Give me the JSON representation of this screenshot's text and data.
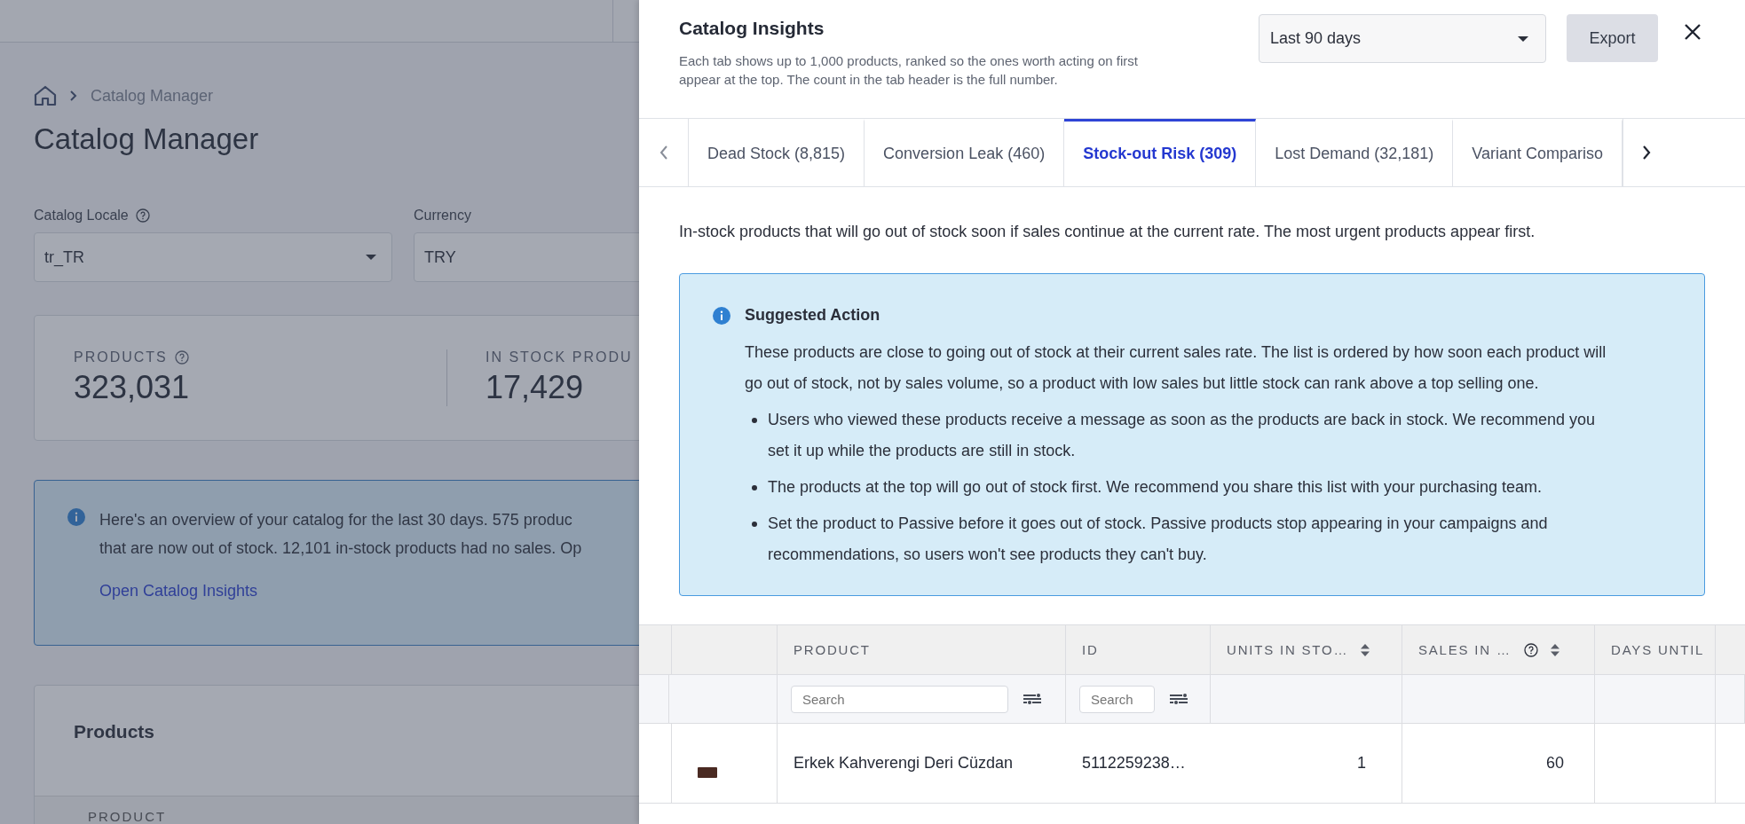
{
  "page": {
    "breadcrumb": {
      "current": "Catalog Manager"
    },
    "title": "Catalog Manager",
    "fields": [
      {
        "label": "Catalog Locale",
        "help": true,
        "value": "tr_TR",
        "dropdown": true
      },
      {
        "label": "Currency",
        "help": false,
        "value": "TRY"
      }
    ],
    "stats": [
      {
        "label": "PRODUCTS",
        "help": true,
        "value": "323,031"
      },
      {
        "label": "IN STOCK PRODU",
        "help": false,
        "value": "17,429"
      }
    ],
    "notice": {
      "lines": [
        "Here's an overview of your catalog for the last 30 days. 575 produc",
        "that are now out of stock. 12,101 in-stock products had no sales. Op"
      ],
      "link": "Open Catalog Insights"
    },
    "products": {
      "title": "Products",
      "column": "PRODUCT"
    }
  },
  "panel": {
    "title": "Catalog Insights",
    "description": "Each tab shows up to 1,000 products, ranked so the ones worth acting on first appear at the top. The count in the tab header is the full number.",
    "period": "Last 90 days",
    "export": "Export",
    "tabs": [
      {
        "label": "Dead Stock (8,815)",
        "selected": false
      },
      {
        "label": "Conversion Leak (460)",
        "selected": false
      },
      {
        "label": "Stock-out Risk (309)",
        "selected": true
      },
      {
        "label": "Lost Demand (32,181)",
        "selected": false
      },
      {
        "label": "Variant Compariso",
        "selected": false
      }
    ],
    "intro": "In-stock products that will go out of stock soon if sales continue at the current rate. The most urgent products appear first.",
    "suggestion": {
      "title": "Suggested Action",
      "text": "These products are close to going out of stock at their current sales rate. The list is ordered by how soon each product will go out of stock, not by sales volume, so a product with low sales but little stock can rank above a top selling one.",
      "bullets": [
        "Users who viewed these products receive a message as soon as the products are back in stock. We recommend you set it up while the products are still in stock.",
        "The products at the top will go out of stock first. We recommend you share this list with your purchasing team.",
        "Set the product to Passive before it goes out of stock. Passive products stop appearing in your campaigns and recommendations, so users won't see products they can't buy."
      ]
    },
    "table": {
      "columns": [
        {
          "label": "PRODUCT",
          "placeholder": "Search",
          "sortable": false,
          "help": false
        },
        {
          "label": "ID",
          "placeholder": "Search",
          "sortable": false,
          "help": false
        },
        {
          "label": "UNITS IN STO…",
          "sortable": true,
          "help": false
        },
        {
          "label": "SALES IN …",
          "sortable": true,
          "help": true
        },
        {
          "label": "DAYS UNTIL",
          "sortable": false,
          "help": false
        }
      ],
      "rows": [
        {
          "cells": [
            "Erkek Kahverengi Deri Cüzdan",
            "5112259238…",
            "1",
            "60"
          ]
        }
      ]
    }
  }
}
